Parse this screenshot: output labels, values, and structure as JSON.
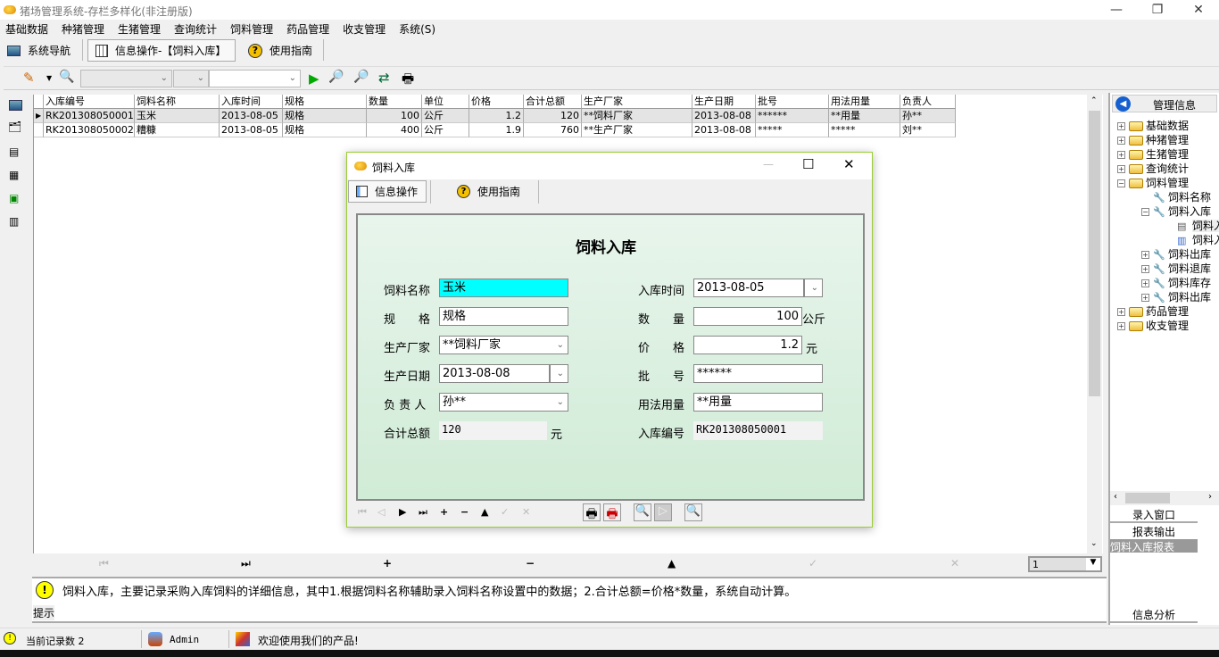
{
  "app": {
    "title": "猪场管理系统-存栏多样化(非注册版)"
  },
  "menu": [
    "基础数据",
    "种猪管理",
    "生猪管理",
    "查询统计",
    "饲料管理",
    "药品管理",
    "收支管理",
    "系统(S)"
  ],
  "tabs": [
    {
      "label": "系统导航"
    },
    {
      "label": "信息操作-【饲料入库】"
    },
    {
      "label": "使用指南"
    }
  ],
  "grid": {
    "columns": [
      "入库编号",
      "饲料名称",
      "入库时间",
      "规格",
      "数量",
      "单位",
      "价格",
      "合计总额",
      "生产厂家",
      "生产日期",
      "批号",
      "用法用量",
      "负责人"
    ],
    "rows": [
      [
        "RK201308050001",
        "玉米",
        "2013-08-05",
        "规格",
        "100",
        "公斤",
        "1.2",
        "120",
        "**饲料厂家",
        "2013-08-08",
        "******",
        "**用量",
        "孙**"
      ],
      [
        "RK201308050002",
        "糟糠",
        "2013-08-05",
        "规格",
        "400",
        "公斤",
        "1.9",
        "760",
        "**生产厂家",
        "2013-08-08",
        "*****",
        "*****",
        "刘**"
      ]
    ],
    "page_select": "1"
  },
  "hint": {
    "text": "饲料入库，主要记录采购入库饲料的详细信息，其中1.根据饲料名称辅助录入饲料名称设置中的数据；2.合计总额=价格*数量，系统自动计算。",
    "label": "提示"
  },
  "right_panel": {
    "title": "管理信息",
    "tree": [
      "基础数据",
      "种猪管理",
      "生猪管理",
      "查询统计",
      "饲料管理",
      "饲料名称",
      "饲料入库",
      "饲料入库",
      "饲料入库",
      "饲料出库",
      "饲料退库",
      "饲料库存",
      "饲料出库",
      "药品管理",
      "收支管理"
    ],
    "buttons": [
      "录入窗口",
      "报表输出",
      "饲料入库报表",
      "信息分析"
    ]
  },
  "status": {
    "records": "当前记录数 2",
    "user": "Admin",
    "welcome": "欢迎使用我们的产品!"
  },
  "dialog": {
    "title": "饲料入库",
    "tabs": [
      "信息操作",
      "使用指南"
    ],
    "heading": "饲料入库",
    "fields": {
      "feed_name": {
        "label": "饲料名称",
        "value": "玉米"
      },
      "spec": {
        "label": "规　　格",
        "value": "规格"
      },
      "maker": {
        "label": "生产厂家",
        "value": "**饲料厂家"
      },
      "prod_date": {
        "label": "生产日期",
        "value": "2013-08-08"
      },
      "person": {
        "label": "负 责 人",
        "value": "孙**"
      },
      "total": {
        "label": "合计总额",
        "value": "120",
        "unit": "元"
      },
      "in_time": {
        "label": "入库时间",
        "value": "2013-08-05"
      },
      "qty": {
        "label": "数　　量",
        "value": "100",
        "unit": "公斤"
      },
      "price": {
        "label": "价　　格",
        "value": "1.2",
        "unit": "元"
      },
      "batch": {
        "label": "批　　号",
        "value": "******"
      },
      "usage": {
        "label": "用法用量",
        "value": "**用量"
      },
      "in_no": {
        "label": "入库编号",
        "value": "RK201308050001"
      }
    }
  },
  "colors": {
    "highlight_field": "#00ffff",
    "dialog_border": "#9acd32"
  }
}
